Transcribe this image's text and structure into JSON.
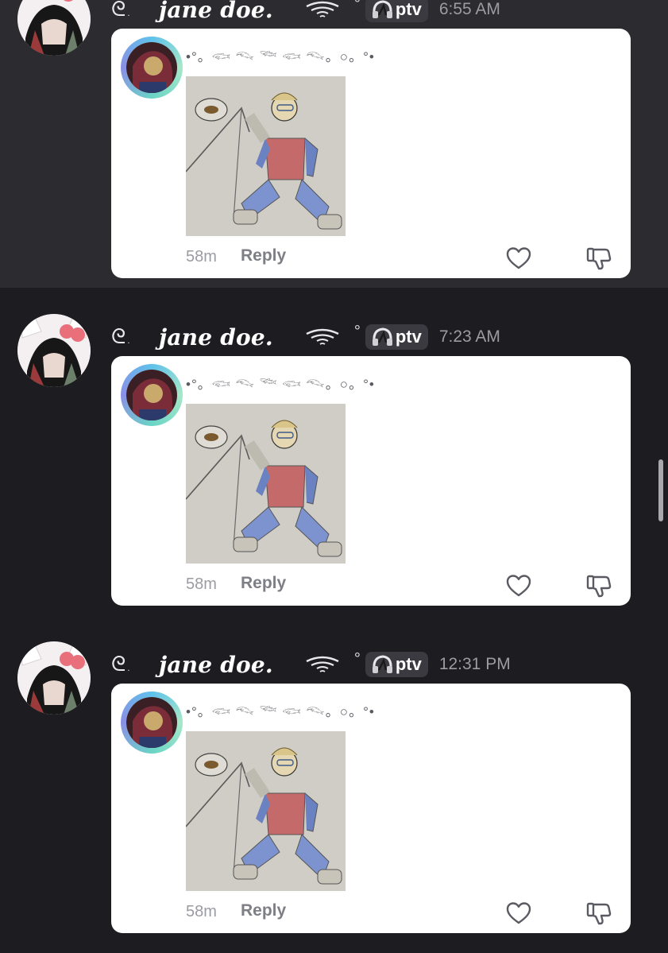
{
  "messages": [
    {
      "deco_prefix": "ᘓ",
      "deco_dot": ".",
      "username": "jane doe.",
      "degree": "°",
      "tag": "ptv",
      "time": "6:55 AM",
      "card_text": "•°。𓆟 𓆞 𓆝 𓆟 𓆞。○。°•",
      "age": "58m",
      "reply": "Reply"
    },
    {
      "deco_prefix": "ᘓ",
      "deco_dot": ".",
      "username": "jane doe.",
      "degree": "°",
      "tag": "ptv",
      "time": "7:23 AM",
      "card_text": "•°。𓆟 𓆞 𓆝 𓆟 𓆞。○。°•",
      "age": "58m",
      "reply": "Reply"
    },
    {
      "deco_prefix": "ᘓ",
      "deco_dot": ".",
      "username": "jane doe.",
      "degree": "°",
      "tag": "ptv",
      "time": "12:31 PM",
      "card_text": "•°。𓆟 𓆞 𓆝 𓆟 𓆞。○。°•",
      "age": "58m",
      "reply": "Reply"
    }
  ],
  "icons": {
    "tag_icon": "headphones-icon",
    "like": "heart-icon",
    "dislike": "thumbs-down-icon",
    "signal": "signal-waves-icon"
  },
  "colors": {
    "background": "#1c1c21",
    "card": "#ffffff",
    "time": "#9b9ba2",
    "avatar_ring": "#5fc1ea"
  }
}
